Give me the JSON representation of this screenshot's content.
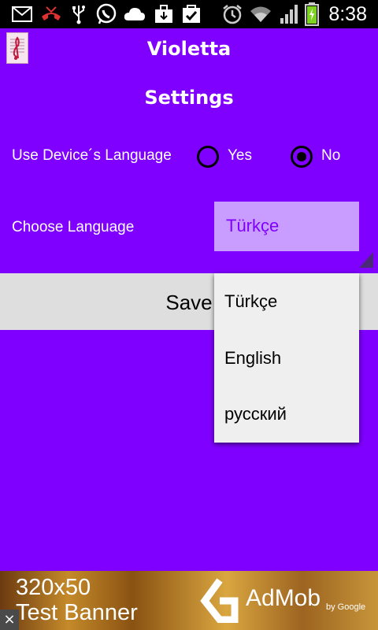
{
  "status_bar": {
    "time": "8:38",
    "icons": [
      "mail-icon",
      "missed-call-icon",
      "usb-icon",
      "whatsapp-icon",
      "cloud-icon",
      "download-icon",
      "task-icon",
      "alarm-icon",
      "wifi-icon",
      "signal-icon",
      "battery-icon"
    ]
  },
  "app": {
    "title": "Violetta",
    "icon": "music-note-icon"
  },
  "screen": {
    "title": "Settings"
  },
  "device_language": {
    "label": "Use Device´s Language",
    "options": [
      {
        "label": "Yes",
        "checked": false
      },
      {
        "label": "No",
        "checked": true
      }
    ]
  },
  "choose_language": {
    "label": "Choose Language",
    "selected": "Türkçe"
  },
  "save": {
    "label": "Save"
  },
  "language_dropdown": {
    "items": [
      "Türkçe",
      "English",
      "русский"
    ]
  },
  "ad_banner": {
    "line1": "320x50",
    "line2": "Test Banner",
    "brand": "AdMob",
    "by": "by Google",
    "close_symbol": "×"
  },
  "colors": {
    "background": "#7f00ff",
    "spinner_bg": "#c99dff",
    "spinner_text": "#7f00ff",
    "button_bg": "#dedede",
    "dropdown_bg": "#efefef"
  }
}
